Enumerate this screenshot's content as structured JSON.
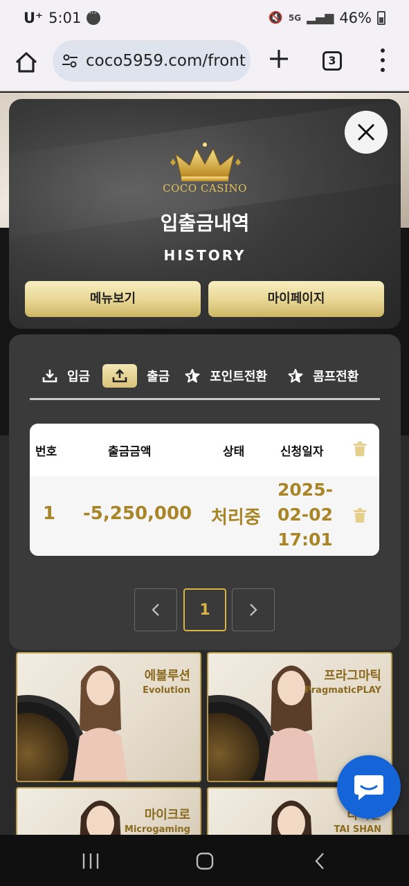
{
  "status_bar": {
    "carrier": "U⁺",
    "time": "5:01",
    "network": "5G",
    "battery": "46%"
  },
  "browser": {
    "url": "coco5959.com/front",
    "tab_count": "3"
  },
  "modal": {
    "logo_text": "COCO CASINO",
    "title": "입출금내역",
    "subtitle": "HISTORY",
    "menu_button": "메뉴보기",
    "mypage_button": "마이페이지",
    "tabs": [
      {
        "label": "입금",
        "icon": "download-icon"
      },
      {
        "label": "출금",
        "icon": "upload-icon",
        "active": true
      },
      {
        "label": "포인트전환",
        "icon": "star-icon"
      },
      {
        "label": "콤프전환",
        "icon": "star-icon"
      }
    ],
    "table": {
      "headers": [
        "번호",
        "출금금액",
        "상태",
        "신청일자"
      ],
      "rows": [
        {
          "no": "1",
          "amount": "-5,250,000",
          "status": "처리중",
          "date_line1": "2025-",
          "date_line2": "02-02",
          "date_line3": "17:01"
        }
      ]
    },
    "pagination": {
      "current": "1"
    }
  },
  "games": [
    {
      "name_ko": "에볼루션",
      "name_en": "Evolution"
    },
    {
      "name_ko": "프라그마틱",
      "name_en": "PragmaticPLAY"
    },
    {
      "name_ko": "마이크로",
      "name_en": "Microgaming"
    },
    {
      "name_ko": "타이샨",
      "name_en": "TAI SHAN"
    }
  ],
  "colors": {
    "accent_gold": "#a88527",
    "chat_blue": "#1565d8"
  }
}
